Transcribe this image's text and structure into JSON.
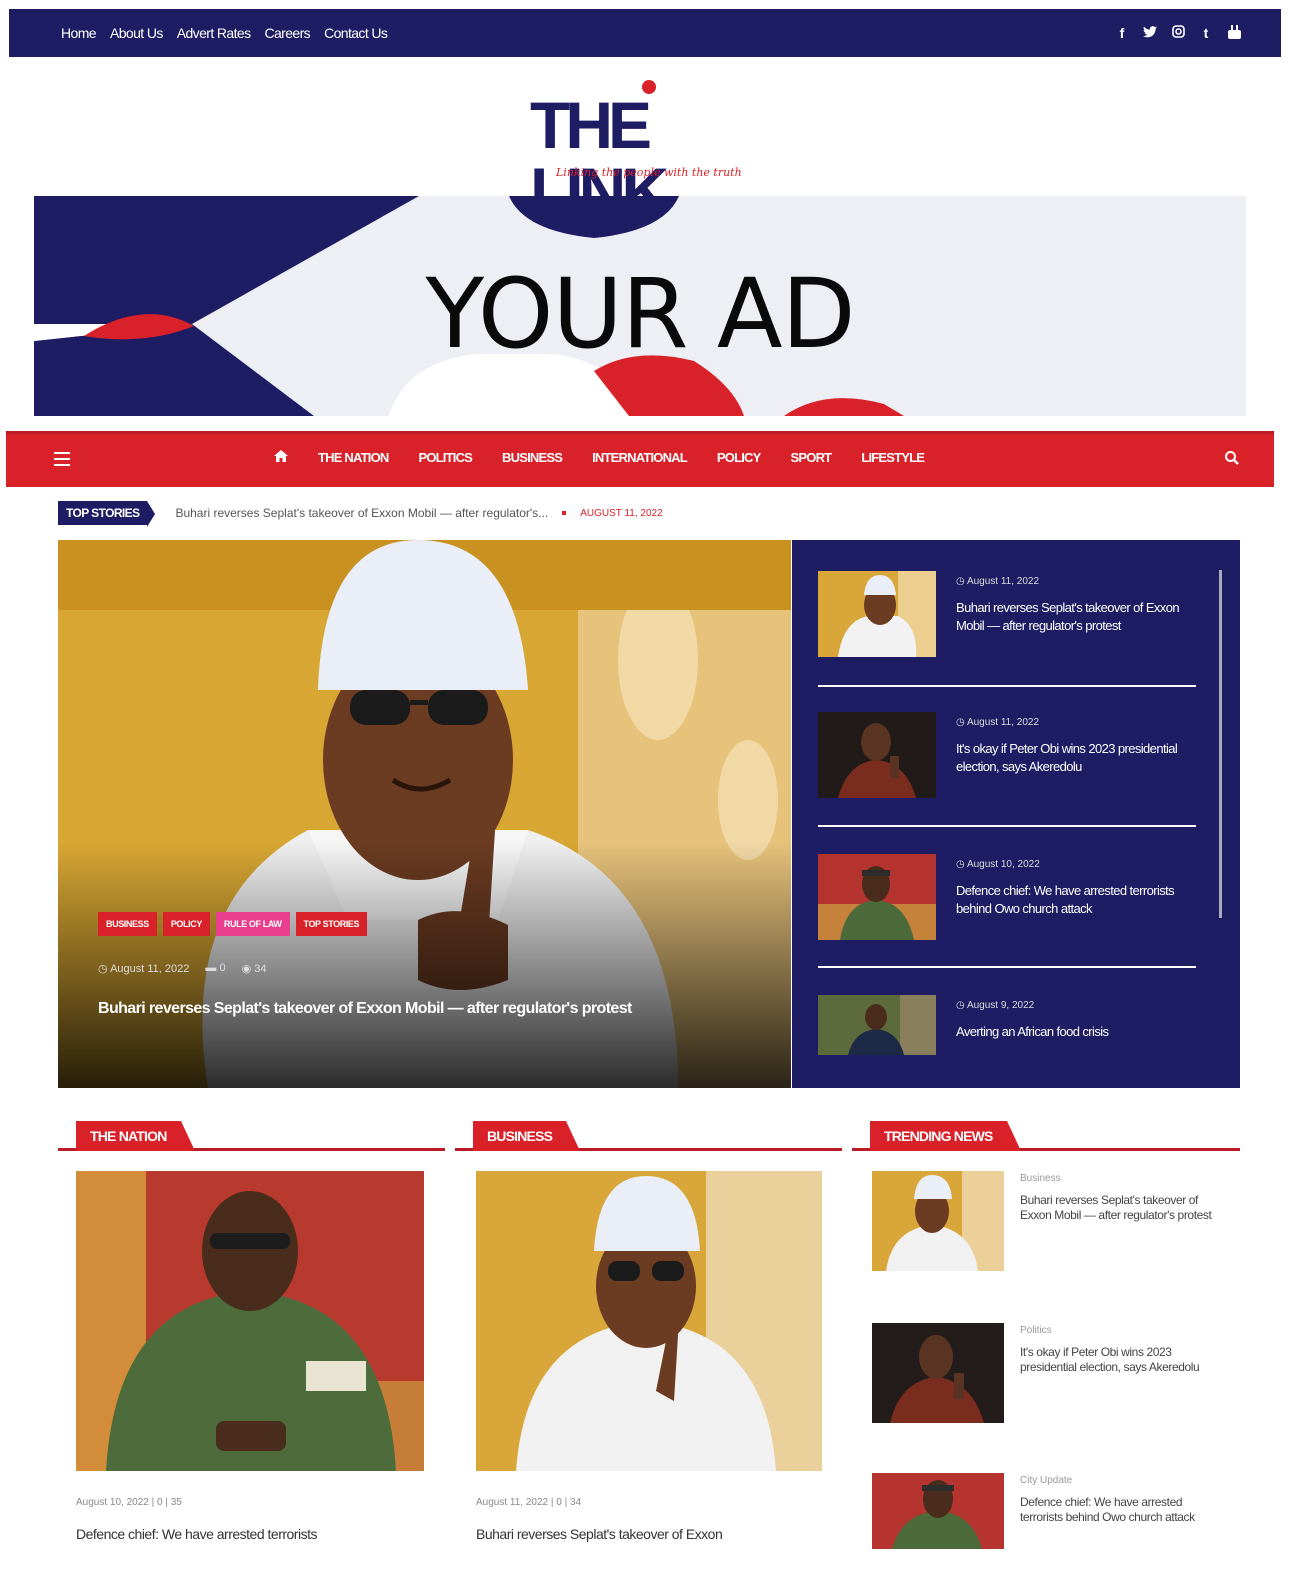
{
  "topbar": {
    "links": [
      "Home",
      "About Us",
      "Advert Rates",
      "Careers",
      "Contact Us"
    ],
    "social_icons": [
      "facebook-icon",
      "twitter-icon",
      "instagram-icon",
      "tumblr-icon",
      "youtube-icon"
    ]
  },
  "logo": {
    "text": "THE LINK",
    "tagline": "Linking the people with the truth"
  },
  "ad": {
    "text": "YOUR AD"
  },
  "nav": {
    "items": [
      "THE NATION",
      "POLITICS",
      "BUSINESS",
      "INTERNATIONAL",
      "POLICY",
      "SPORT",
      "LIFESTYLE"
    ]
  },
  "ticker": {
    "label": "TOP STORIES",
    "text": "Buhari reverses Seplat's takeover of Exxon Mobil — after regulator's...",
    "date": "AUGUST 11, 2022"
  },
  "hero": {
    "tags": [
      "BUSINESS",
      "POLICY",
      "RULE OF LAW",
      "TOP STORIES"
    ],
    "date": "August 11, 2022",
    "comments": "0",
    "views": "34",
    "title": "Buhari reverses Seplat's takeover of Exxon Mobil — after regulator's protest"
  },
  "side_list": [
    {
      "date": "August 11, 2022",
      "title": "Buhari reverses Seplat's takeover of Exxon Mobil — after regulator's protest"
    },
    {
      "date": "August 11, 2022",
      "title": "It's okay if Peter Obi wins 2023 presidential election, says Akeredolu"
    },
    {
      "date": "August 10, 2022",
      "title": "Defence chief: We have arrested terrorists behind Owo church attack"
    },
    {
      "date": "August 9, 2022",
      "title": "Averting an African food crisis"
    }
  ],
  "sections": {
    "nation": {
      "label": "THE NATION",
      "meta": "August 10, 2022 | 0 | 35",
      "title": "Defence chief: We have arrested terrorists"
    },
    "business": {
      "label": "BUSINESS",
      "meta": "August 11, 2022 | 0 | 34",
      "title": "Buhari reverses Seplat's takeover of Exxon"
    },
    "trending": {
      "label": "TRENDING NEWS",
      "items": [
        {
          "category": "Business",
          "title": "Buhari reverses Seplat's takeover of Exxon Mobil — after regulator's protest"
        },
        {
          "category": "Politics",
          "title": "It's okay if Peter Obi wins 2023 presidential election, says Akeredolu"
        },
        {
          "category": "City Update",
          "title": "Defence chief: We have arrested terrorists behind Owo church attack"
        }
      ]
    }
  },
  "colors": {
    "navy": "#1e1c63",
    "red": "#d9212a",
    "pink": "#e83f8e"
  }
}
